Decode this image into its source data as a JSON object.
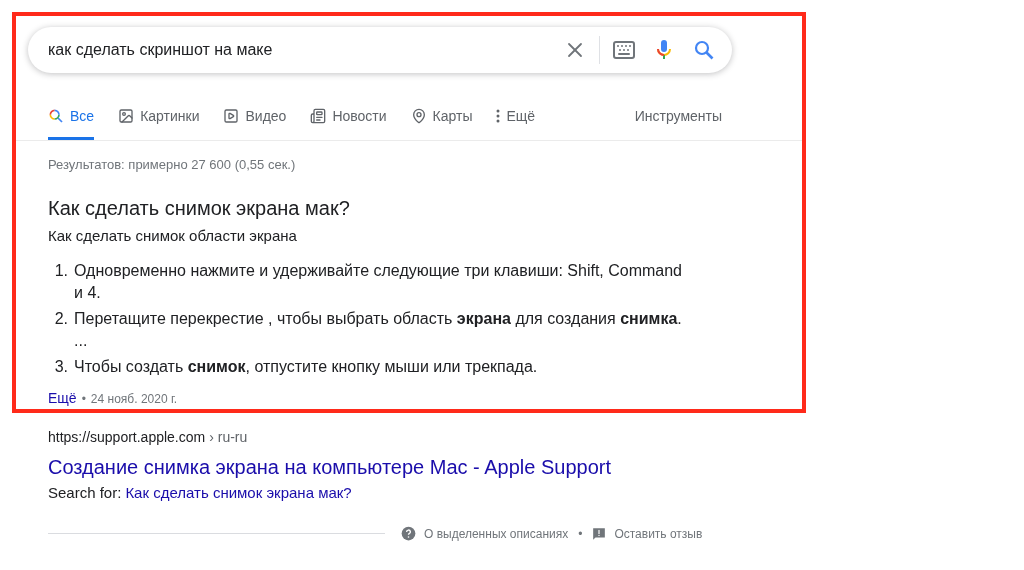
{
  "search": {
    "value": "как сделать скриншот на маке"
  },
  "tabs": [
    {
      "kind": "all",
      "label": "Все",
      "selected": true
    },
    {
      "kind": "images",
      "label": "Картинки",
      "selected": false
    },
    {
      "kind": "video",
      "label": "Видео",
      "selected": false
    },
    {
      "kind": "news",
      "label": "Новости",
      "selected": false
    },
    {
      "kind": "maps",
      "label": "Карты",
      "selected": false
    },
    {
      "kind": "more",
      "label": "Ещё",
      "selected": false
    }
  ],
  "tools": "Инструменты",
  "results_count": "Результатов: примерно 27 600 (0,55 сек.)",
  "snippet": {
    "question": "Как сделать снимок экрана мак?",
    "subtitle": "Как сделать снимок области экрана",
    "steps": [
      {
        "number": "1.",
        "text": "Одновременно нажмите и удерживайте следующие три клавиши: Shift, Command и 4."
      },
      {
        "number": "2.",
        "text": "Перетащите перекрестие , чтобы выбрать область **экрана** для создания **снимка**. ..."
      },
      {
        "number": "3.",
        "text": "Чтобы создать **снимок**, отпустите кнопку мыши или трекпада."
      }
    ],
    "more_link": "Ещё",
    "separator": "•",
    "date": "24 нояб. 2020 г."
  },
  "result": {
    "url": "https://support.apple.com",
    "breadcrumb": "› ru-ru",
    "title": "Создание снимка экрана на компьютере Mac - Apple Support",
    "search_for_label": "Search for:",
    "search_for_link": "Как сделать снимок экрана мак?"
  },
  "footer": {
    "about": "О выделенных описаниях",
    "separator": "•",
    "feedback": "Оставить отзыв"
  }
}
